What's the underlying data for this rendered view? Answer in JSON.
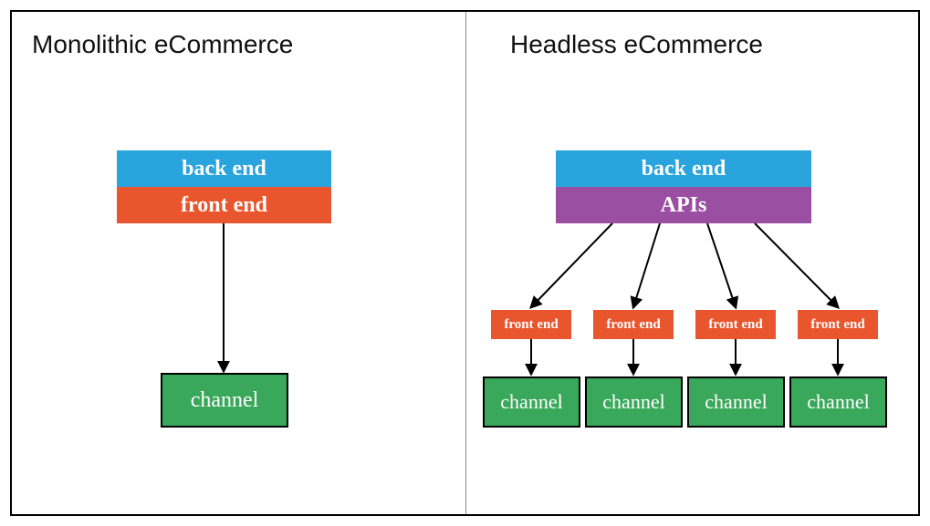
{
  "left": {
    "title": "Monolithic eCommerce",
    "backend": "back end",
    "frontend": "front end",
    "channel": "channel"
  },
  "right": {
    "title": "Headless eCommerce",
    "backend": "back end",
    "apis": "APIs",
    "frontends": [
      "front end",
      "front end",
      "front end",
      "front end"
    ],
    "channels": [
      "channel",
      "channel",
      "channel",
      "channel"
    ]
  },
  "colors": {
    "backend": "#29A4DC",
    "frontend": "#E9552D",
    "apis": "#9A4FA2",
    "channel": "#39A85B"
  }
}
